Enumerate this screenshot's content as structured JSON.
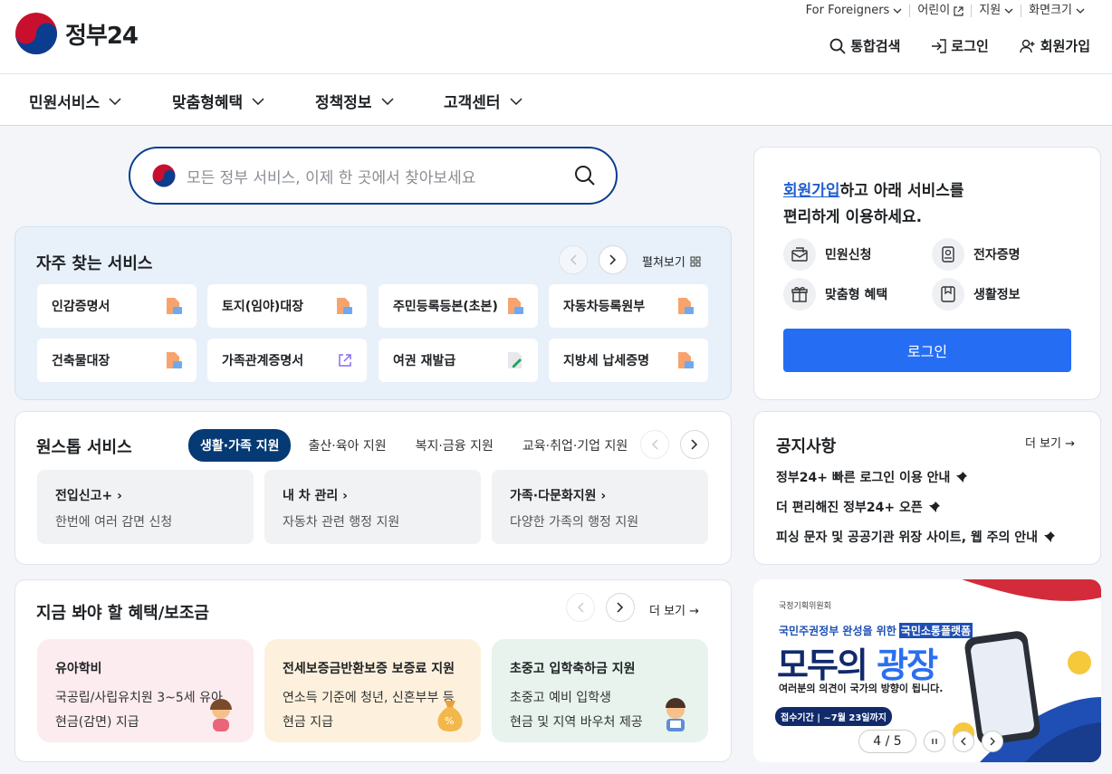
{
  "header": {
    "logo_text": "정부24",
    "utility": [
      "For Foreigners",
      "어린이",
      "지원",
      "화면크기"
    ],
    "search_label": "통합검색",
    "login_label": "로그인",
    "signup_label": "회원가입"
  },
  "nav": [
    "민원서비스",
    "맞춤형혜택",
    "정책정보",
    "고객센터"
  ],
  "search": {
    "placeholder": "모든 정부 서비스, 이제 한 곳에서 찾아보세요"
  },
  "favorites": {
    "title": "자주 찾는 서비스",
    "expand": "펼쳐보기",
    "items": [
      "인감증명서",
      "토지(임야)대장",
      "주민등록등본(초본)",
      "자동차등록원부",
      "건축물대장",
      "가족관계증명서",
      "여권 재발급",
      "지방세 납세증명"
    ]
  },
  "onestop": {
    "title": "원스톱 서비스",
    "tabs": [
      "생활·가족 지원",
      "출산·육아 지원",
      "복지·금융 지원",
      "교육·취업·기업 지원"
    ],
    "items": [
      {
        "title": "전입신고+",
        "desc": "한번에 여러 감면 신청"
      },
      {
        "title": "내 차 관리",
        "desc": "자동차 관련 행정 지원"
      },
      {
        "title": "가족·다문화지원",
        "desc": "다양한 가족의 행정 지원"
      }
    ]
  },
  "benefits": {
    "title": "지금 봐야 할 혜택/보조금",
    "more": "더 보기",
    "items": [
      {
        "title": "유아학비",
        "line1": "국공립/사립유치원 3~5세 유아",
        "line2": "현금(감면) 지급",
        "bg": "#fcecef"
      },
      {
        "title": "전세보증금반환보증 보증료 지원",
        "line1": "연소득 기준에 청년, 신혼부부 등",
        "line2": "현금 지급",
        "bg": "#fdf1dd"
      },
      {
        "title": "초중고 입학축하금 지원",
        "line1": "초중고 예비 입학생",
        "line2": "현금 및 지역 바우처 제공",
        "bg": "#e7f3ec"
      }
    ]
  },
  "join": {
    "link": "회원가입",
    "line1_rest": "하고 아래 서비스를",
    "line2": "편리하게 이용하세요.",
    "services": [
      "민원신청",
      "전자증명",
      "맞춤형 혜택",
      "생활정보"
    ],
    "button": "로그인"
  },
  "notice": {
    "title": "공지사항",
    "more": "더 보기",
    "items": [
      "정부24+ 빠른 로그인 이용 안내",
      "더 편리해진 정부24+ 오픈",
      "피싱 문자 및 공공기관 위장 사이트, 웹 주의 안내"
    ]
  },
  "banner": {
    "org": "국정기획위원회",
    "sub_a": "국민주권정부 완성을 위한",
    "sub_b": "국민소통플랫폼",
    "title_a": "모두의",
    "title_b": "광장",
    "desc": "여러분의 의견이 국가의 방향이 됩니다.",
    "period": "접수기간 | ~7월 23일까지",
    "page": "4 / 5"
  },
  "colors": {
    "brand": "#063a74",
    "primary": "#256ef4",
    "link": "#1f5fcf"
  }
}
